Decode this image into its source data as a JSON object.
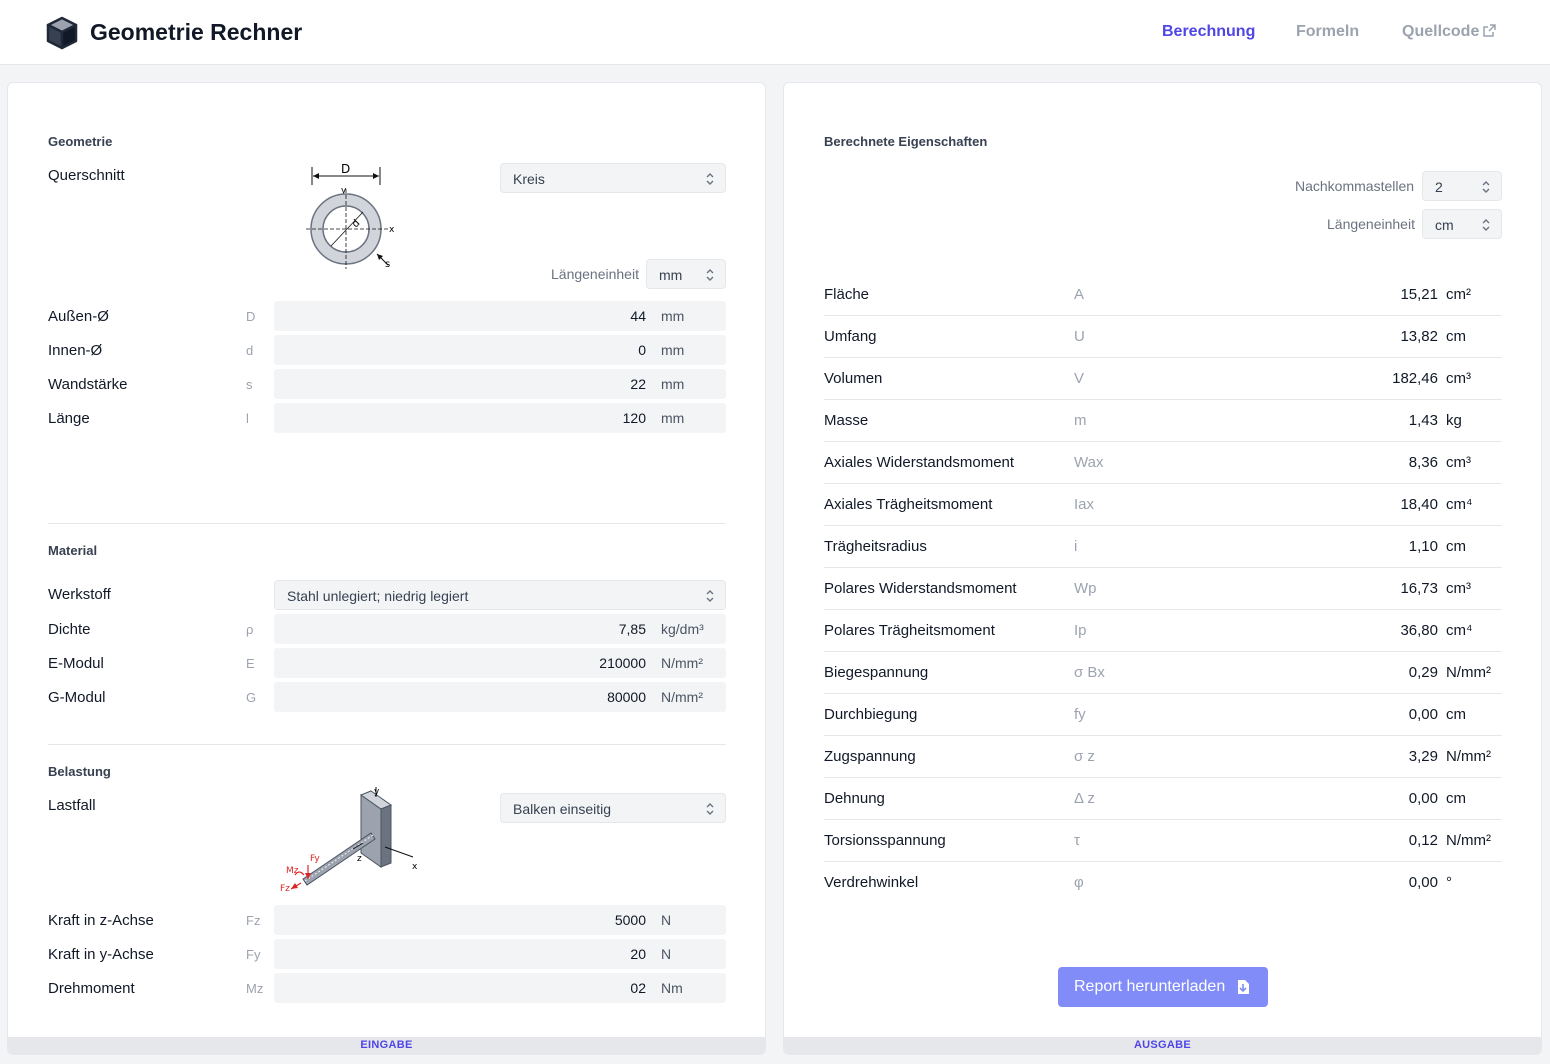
{
  "header": {
    "title": "Geometrie Rechner",
    "nav": [
      {
        "label": "Berechnung",
        "active": true
      },
      {
        "label": "Formeln",
        "active": false
      },
      {
        "label": "Quellcode",
        "active": false
      }
    ]
  },
  "input": {
    "footer": "EINGABE",
    "geometry": {
      "title": "Geometrie",
      "section_label": "Querschnitt",
      "section_value": "Kreis",
      "diagram_labels": {
        "D": "D",
        "d": "d",
        "s": "s",
        "x": "x",
        "y": "y"
      },
      "unit_label": "Längeneinheit",
      "unit_value": "mm",
      "rows": [
        {
          "label": "Außen-Ø",
          "symbol": "D",
          "value": "44",
          "unit": "mm"
        },
        {
          "label": "Innen-Ø",
          "symbol": "d",
          "value": "0",
          "unit": "mm"
        },
        {
          "label": "Wandstärke",
          "symbol": "s",
          "value": "22",
          "unit": "mm"
        },
        {
          "label": "Länge",
          "symbol": "l",
          "value": "120",
          "unit": "mm"
        }
      ]
    },
    "material": {
      "title": "Material",
      "material_label": "Werkstoff",
      "material_value": "Stahl unlegiert; niedrig legiert",
      "rows": [
        {
          "label": "Dichte",
          "symbol": "ρ",
          "value": "7,85",
          "unit": "kg/dm³"
        },
        {
          "label": "E-Modul",
          "symbol": "E",
          "value": "210000",
          "unit": "N/mm²"
        },
        {
          "label": "G-Modul",
          "symbol": "G",
          "value": "80000",
          "unit": "N/mm²"
        }
      ]
    },
    "load": {
      "title": "Belastung",
      "case_label": "Lastfall",
      "case_value": "Balken einseitig",
      "diagram_labels": {
        "y": "y",
        "x": "x",
        "z": "z",
        "Fy": "Fy",
        "Mz": "Mz",
        "Fz": "Fz"
      },
      "rows": [
        {
          "label": "Kraft in z-Achse",
          "symbol": "Fz",
          "value": "5000",
          "unit": "N"
        },
        {
          "label": "Kraft in y-Achse",
          "symbol": "Fy",
          "value": "20",
          "unit": "N"
        },
        {
          "label": "Drehmoment",
          "symbol": "Mz",
          "value": "02",
          "unit": "Nm"
        }
      ]
    }
  },
  "output": {
    "title": "Berechnete Eigenschaften",
    "footer": "AUSGABE",
    "decimals_label": "Nachkommastellen",
    "decimals_value": "2",
    "unit_label": "Längeneinheit",
    "unit_value": "cm",
    "results": [
      {
        "name": "Fläche",
        "symbol": "A",
        "value": "15,21",
        "unit": "cm²"
      },
      {
        "name": "Umfang",
        "symbol": "U",
        "value": "13,82",
        "unit": "cm"
      },
      {
        "name": "Volumen",
        "symbol": "V",
        "value": "182,46",
        "unit": "cm³"
      },
      {
        "name": "Masse",
        "symbol": "m",
        "value": "1,43",
        "unit": "kg"
      },
      {
        "name": "Axiales Widerstandsmoment",
        "symbol": "Wax",
        "value": "8,36",
        "unit": "cm³"
      },
      {
        "name": "Axiales Trägheitsmoment",
        "symbol": "Iax",
        "value": "18,40",
        "unit": "cm⁴"
      },
      {
        "name": "Trägheitsradius",
        "symbol": "i",
        "value": "1,10",
        "unit": "cm"
      },
      {
        "name": "Polares Widerstandsmoment",
        "symbol": "Wp",
        "value": "16,73",
        "unit": "cm³"
      },
      {
        "name": "Polares Trägheitsmoment",
        "symbol": "Ip",
        "value": "36,80",
        "unit": "cm⁴"
      },
      {
        "name": "Biegespannung",
        "symbol": "σ Bx",
        "value": "0,29",
        "unit": "N/mm²"
      },
      {
        "name": "Durchbiegung",
        "symbol": "fy",
        "value": "0,00",
        "unit": "cm"
      },
      {
        "name": "Zugspannung",
        "symbol": "σ z",
        "value": "3,29",
        "unit": "N/mm²"
      },
      {
        "name": "Dehnung",
        "symbol": "Δ z",
        "value": "0,00",
        "unit": "cm"
      },
      {
        "name": "Torsionsspannung",
        "symbol": "τ",
        "value": "0,12",
        "unit": "N/mm²"
      },
      {
        "name": "Verdrehwinkel",
        "symbol": "φ",
        "value": "0,00",
        "unit": "°"
      }
    ],
    "download_label": "Report herunterladen"
  }
}
